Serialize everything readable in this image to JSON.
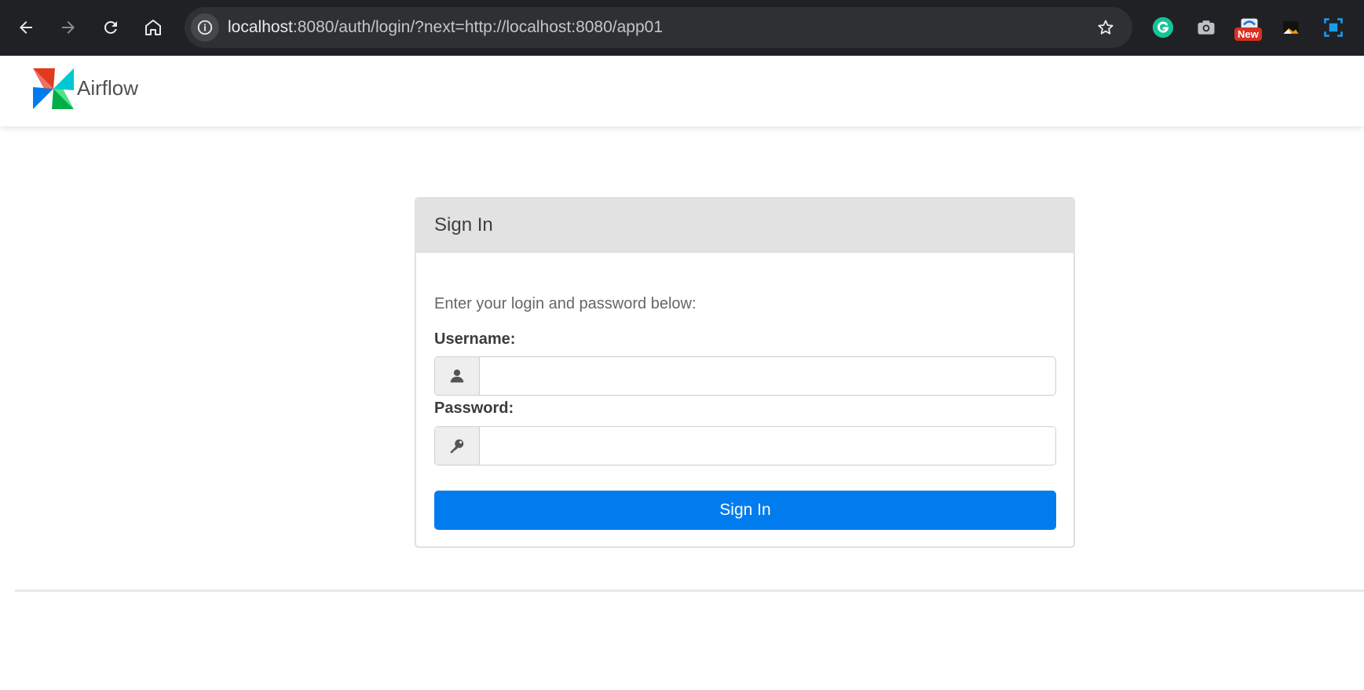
{
  "browser": {
    "url_host": "localhost",
    "url_rest": ":8080/auth/login/?next=http://localhost:8080/app01",
    "extension_badge": "New"
  },
  "navbar": {
    "brand": "Airflow"
  },
  "login": {
    "title": "Sign In",
    "intro": "Enter your login and password below:",
    "username_label": "Username:",
    "username_value": "",
    "password_label": "Password:",
    "password_value": "",
    "submit_label": "Sign In"
  },
  "colors": {
    "primary_button": "#017cee",
    "chrome_bg": "#202124"
  }
}
